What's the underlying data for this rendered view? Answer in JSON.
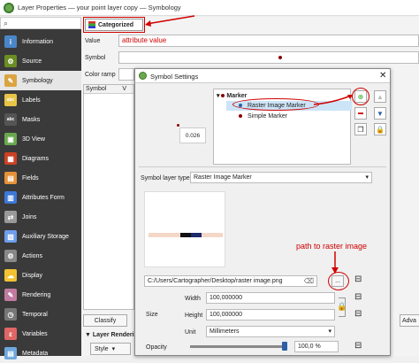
{
  "window": {
    "title": "Layer Properties — your point layer copy — Symbology",
    "search_glyph": "⌕"
  },
  "sidebar": {
    "items": [
      {
        "label": "Information",
        "icon": "info-icon",
        "color": "#4a86c8",
        "glyph": "i"
      },
      {
        "label": "Source",
        "icon": "source-icon",
        "color": "#6b8e23",
        "glyph": "⚙"
      },
      {
        "label": "Symbology",
        "icon": "symbology-icon",
        "color": "#d9a441",
        "glyph": "✎"
      },
      {
        "label": "Labels",
        "icon": "labels-icon",
        "color": "#e8c547",
        "glyph": "abc"
      },
      {
        "label": "Masks",
        "icon": "masks-icon",
        "color": "#555555",
        "glyph": "abc"
      },
      {
        "label": "3D View",
        "icon": "3d-view-icon",
        "color": "#6aa84f",
        "glyph": "▣"
      },
      {
        "label": "Diagrams",
        "icon": "diagrams-icon",
        "color": "#cc4125",
        "glyph": "▦"
      },
      {
        "label": "Fields",
        "icon": "fields-icon",
        "color": "#e69138",
        "glyph": "▤"
      },
      {
        "label": "Attributes Form",
        "icon": "attributes-form-icon",
        "color": "#3c78d8",
        "glyph": "▥"
      },
      {
        "label": "Joins",
        "icon": "joins-icon",
        "color": "#999999",
        "glyph": "⇄"
      },
      {
        "label": "Auxiliary Storage",
        "icon": "auxiliary-storage-icon",
        "color": "#6d9eeb",
        "glyph": "▧"
      },
      {
        "label": "Actions",
        "icon": "actions-icon",
        "color": "#888888",
        "glyph": "⚙"
      },
      {
        "label": "Display",
        "icon": "display-icon",
        "color": "#f1c232",
        "glyph": "☁"
      },
      {
        "label": "Rendering",
        "icon": "rendering-icon",
        "color": "#c27ba0",
        "glyph": "✎"
      },
      {
        "label": "Temporal",
        "icon": "temporal-icon",
        "color": "#777777",
        "glyph": "◷"
      },
      {
        "label": "Variables",
        "icon": "variables-icon",
        "color": "#e06666",
        "glyph": "ε"
      },
      {
        "label": "Metadata",
        "icon": "metadata-icon",
        "color": "#6fa8dc",
        "glyph": "▤"
      }
    ]
  },
  "main": {
    "renderer": "Categorized",
    "value_label": "Value",
    "value_text": "attribute value",
    "symbol_label": "Symbol",
    "color_ramp_label": "Color ramp",
    "table_header_symbol": "Symbol",
    "table_header_value": "V",
    "classify_label": "Classify",
    "layer_rendering_label": "Layer Renderi",
    "style_label": "Style",
    "adv_label": "Adva"
  },
  "dialog": {
    "title": "Symbol Settings",
    "tree": {
      "root": "Marker",
      "child1": "Raster Image Marker",
      "child2": "Simple Marker"
    },
    "preview_value": "0.026",
    "symbol_layer_type_label": "Symbol layer type",
    "symbol_layer_type_value": "Raster Image Marker",
    "path_value": "C:/Users/Cartographer/Desktop/raster image.png",
    "browse_label": "...",
    "size_label": "Size",
    "width_label": "Width",
    "width_value": "100,000000",
    "height_label": "Height",
    "height_value": "100,000000",
    "unit_label": "Unit",
    "unit_value": "Millimeters",
    "opacity_label": "Opacity",
    "opacity_value": "100,0 %",
    "annotation_path": "path to raster image",
    "preview_strip": [
      "#f4d7c6",
      "#f4d7c6",
      "#f4d7c6",
      "#111111",
      "#1d2a6b",
      "#f4d7c6",
      "#f4d7c6"
    ]
  },
  "colors": {
    "accent_red": "#d00000",
    "sidebar_bg": "#3a3a3a",
    "selection": "#cce4f7"
  }
}
